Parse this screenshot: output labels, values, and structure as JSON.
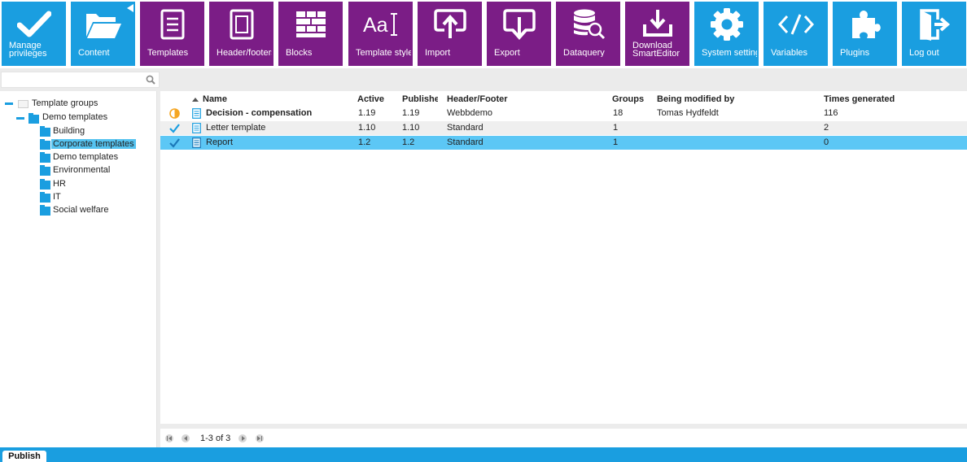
{
  "toolbar": {
    "items": [
      {
        "label": "Manage\nprivileges",
        "icon": "checkmark-icon",
        "color": "#1a9ee0"
      },
      {
        "label": "Content",
        "icon": "folder-open-icon",
        "color": "#1a9ee0"
      },
      {
        "label": "Templates",
        "icon": "document-icon",
        "color": "#7b1d86"
      },
      {
        "label": "Header/footers",
        "icon": "page-frame-icon",
        "color": "#7b1d86"
      },
      {
        "label": "Blocks",
        "icon": "blocks-icon",
        "color": "#7b1d86"
      },
      {
        "label": "Template styles",
        "icon": "text-style-icon",
        "color": "#7b1d86"
      },
      {
        "label": "Import",
        "icon": "upload-icon",
        "color": "#7b1d86"
      },
      {
        "label": "Export",
        "icon": "download-icon",
        "color": "#7b1d86"
      },
      {
        "label": "Dataquery",
        "icon": "database-search-icon",
        "color": "#7b1d86"
      },
      {
        "label": "Download\nSmartEditor",
        "icon": "download-tray-icon",
        "color": "#7b1d86"
      },
      {
        "label": "System settings",
        "icon": "gear-icon",
        "color": "#1a9ee0"
      },
      {
        "label": "Variables",
        "icon": "code-icon",
        "color": "#1a9ee0"
      },
      {
        "label": "Plugins",
        "icon": "puzzle-icon",
        "color": "#1a9ee0"
      },
      {
        "label": "Log out",
        "icon": "logout-icon",
        "color": "#1a9ee0"
      }
    ]
  },
  "search": {
    "value": "",
    "placeholder": ""
  },
  "tree": {
    "root": "Template groups",
    "group": "Demo templates",
    "children": [
      "Building",
      "Corporate templates",
      "Demo templates",
      "Environmental",
      "HR",
      "IT",
      "Social welfare"
    ],
    "selected": "Corporate templates"
  },
  "grid": {
    "columns": {
      "name": "Name",
      "active": "Active",
      "published": "Publishe",
      "header_footer": "Header/Footer",
      "groups": "Groups",
      "modified_by": "Being modified by",
      "times_generated": "Times generated"
    },
    "rows": [
      {
        "status": "in-progress",
        "name": "Decision - compensation",
        "active": "1.19",
        "published": "1.19",
        "header_footer": "Webbdemo",
        "groups": "18",
        "modified_by": "Tomas Hydfeldt",
        "times_generated": "116"
      },
      {
        "status": "published",
        "name": "Letter template",
        "active": "1.10",
        "published": "1.10",
        "header_footer": "Standard",
        "groups": "1",
        "modified_by": "",
        "times_generated": "2"
      },
      {
        "status": "published",
        "name": "Report",
        "active": "1.2",
        "published": "1.2",
        "header_footer": "Standard",
        "groups": "1",
        "modified_by": "",
        "times_generated": "0"
      }
    ],
    "pager": "1-3 of 3"
  },
  "footer": {
    "publish_tab": "Publish"
  },
  "colors": {
    "blue": "#1a9ee0",
    "purple": "#7b1d86",
    "selected_row": "#5cc7f5"
  }
}
